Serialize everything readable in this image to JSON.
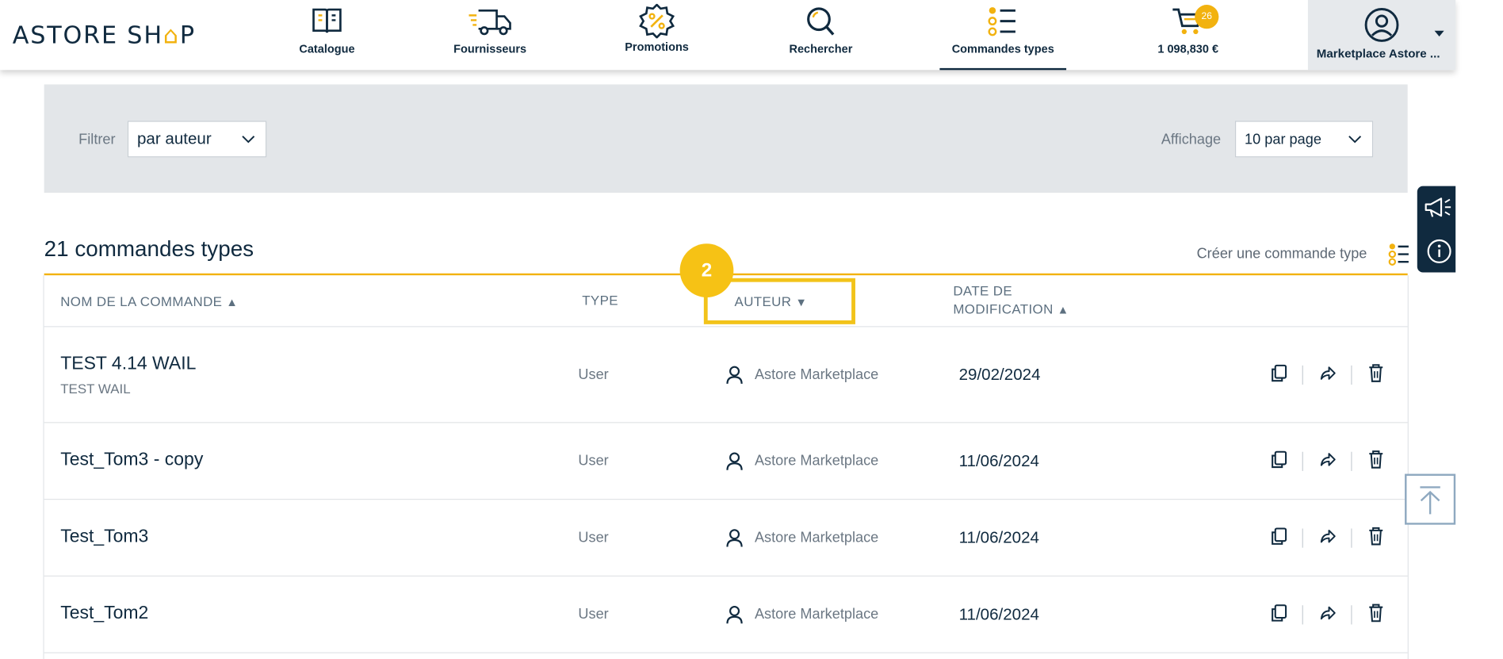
{
  "header": {
    "logo_left": "ASTORE SH",
    "logo_bag": "⌂",
    "logo_right": "P",
    "nav": [
      {
        "label": "Catalogue",
        "icon": "book-icon"
      },
      {
        "label": "Fournisseurs",
        "icon": "truck-icon"
      },
      {
        "label": "Promotions",
        "icon": "discount-badge-icon"
      },
      {
        "label": "Rechercher",
        "icon": "search-icon"
      },
      {
        "label": "Commandes types",
        "icon": "list-icon",
        "active": true
      },
      {
        "label": "1 098,830 €",
        "icon": "cart-icon"
      }
    ],
    "cart_badge": "26",
    "account_label": "Marketplace Astore ..."
  },
  "filters": {
    "filter_label": "Filtrer",
    "filter_value": "par auteur",
    "display_label": "Affichage",
    "display_value": "10 par page"
  },
  "list": {
    "title": "21 commandes types",
    "create_label": "Créer une commande type"
  },
  "table": {
    "headers": {
      "name": "NOM DE LA COMMANDE",
      "name_sort": "▲",
      "type": "TYPE",
      "author": "AUTEUR",
      "author_sort": "▼",
      "date_line1": "DATE DE",
      "date_line2": "MODIFICATION",
      "date_sort": "▲"
    },
    "rows": [
      {
        "name": "TEST 4.14 WAIL",
        "subtitle": "TEST WAIL",
        "type": "User",
        "author": "Astore Marketplace",
        "date": "29/02/2024"
      },
      {
        "name": "Test_Tom3 - copy",
        "subtitle": "",
        "type": "User",
        "author": "Astore Marketplace",
        "date": "11/06/2024"
      },
      {
        "name": "Test_Tom3",
        "subtitle": "",
        "type": "User",
        "author": "Astore Marketplace",
        "date": "11/06/2024"
      },
      {
        "name": "Test_Tom2",
        "subtitle": "",
        "type": "User",
        "author": "Astore Marketplace",
        "date": "11/06/2024"
      }
    ]
  },
  "annotation": {
    "step": "2"
  },
  "colors": {
    "navy": "#102a3f",
    "accent": "#f2b20f",
    "panel": "#e3e6e9"
  }
}
